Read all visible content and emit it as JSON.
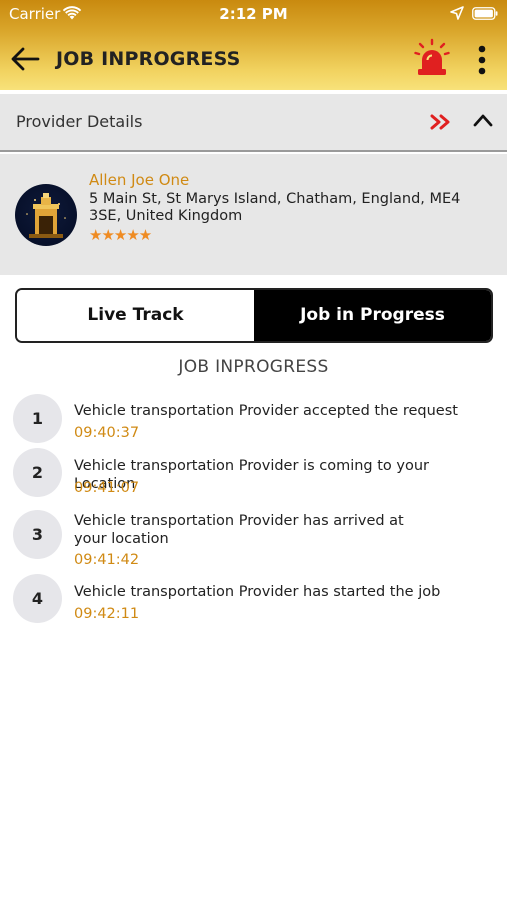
{
  "status_bar": {
    "carrier": "Carrier",
    "time": "2:12 PM"
  },
  "header": {
    "title": "JOB INPROGRESS",
    "icons": [
      "back-arrow-icon",
      "alarm-siren-icon",
      "more-vertical-icon"
    ]
  },
  "provider_section": {
    "label": "Provider Details",
    "icons": [
      "double-chevron-right-icon",
      "chevron-up-icon"
    ]
  },
  "provider": {
    "name": "Allen Joe One",
    "address": "5 Main St, St Marys Island, Chatham, England, ME4 3SE, United Kingdom",
    "rating": 5,
    "rating_stars": "★★★★★"
  },
  "tabs": {
    "live_track": "Live Track",
    "job_in_progress": "Job in Progress",
    "active": "job_in_progress"
  },
  "progress": {
    "title": "JOB INPROGRESS",
    "steps": [
      {
        "number": "1",
        "text": "Vehicle transportation Provider accepted the request",
        "time": "09:40:37"
      },
      {
        "number": "2",
        "text": "Vehicle transportation Provider is coming to your Location",
        "time": "09:41:07"
      },
      {
        "number": "3",
        "text": "Vehicle transportation Provider has arrived at\nyour location",
        "time": "09:41:42"
      },
      {
        "number": "4",
        "text": "Vehicle transportation Provider has started the job",
        "time": "09:42:11"
      }
    ]
  },
  "colors": {
    "header_top": "#c98a0f",
    "header_bottom": "#f8e27a",
    "accent_orange": "#d08a14",
    "alarm_red": "#e02020",
    "star_orange": "#ef8b22",
    "panel_gray": "#e7e7e7"
  }
}
